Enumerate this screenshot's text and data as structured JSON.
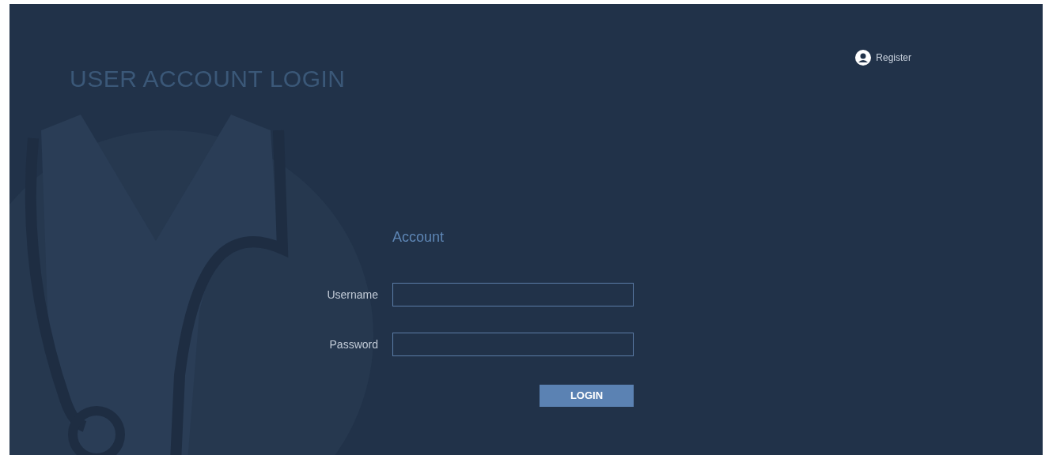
{
  "page": {
    "title": "USER ACCOUNT LOGIN"
  },
  "register_link": {
    "label": "Register"
  },
  "form": {
    "heading": "Account",
    "fields": [
      {
        "label": "Username"
      },
      {
        "label": "Password"
      }
    ],
    "submit": {
      "label": "LOGIN"
    }
  }
}
